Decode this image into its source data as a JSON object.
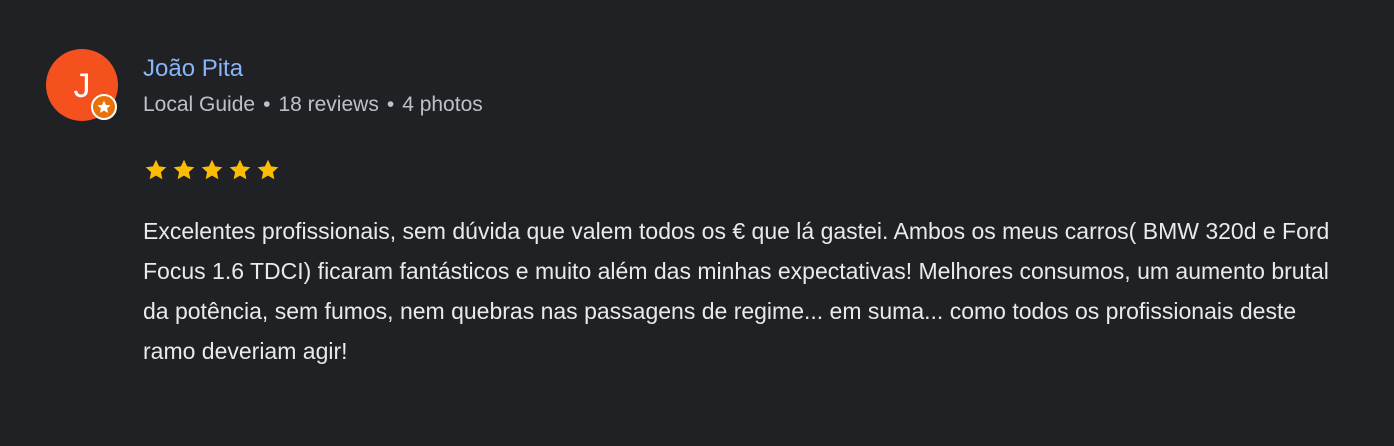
{
  "review": {
    "author": {
      "initial": "J",
      "name": "João Pita",
      "avatar_color": "#f4511e",
      "badge_icon": "local-guide-star-icon"
    },
    "meta": {
      "role": "Local Guide",
      "reviews": "18 reviews",
      "photos": "4 photos",
      "separator": "•"
    },
    "rating": {
      "value": 5,
      "max": 5,
      "star_color": "#fbbc04"
    },
    "text": "Excelentes profissionais, sem dúvida que valem todos os € que lá gastei. Ambos os meus carros( BMW 320d e Ford Focus 1.6 TDCI) ficaram fantásticos e muito além das minhas expectativas! Melhores consumos, um aumento brutal da potência, sem fumos, nem quebras nas passagens de regime... em suma... como todos os profissionais deste ramo deveriam agir!"
  },
  "colors": {
    "background": "#202124",
    "name_link": "#8ab4f8",
    "meta_text": "#bdc1c6",
    "body_text": "#e8eaed"
  }
}
